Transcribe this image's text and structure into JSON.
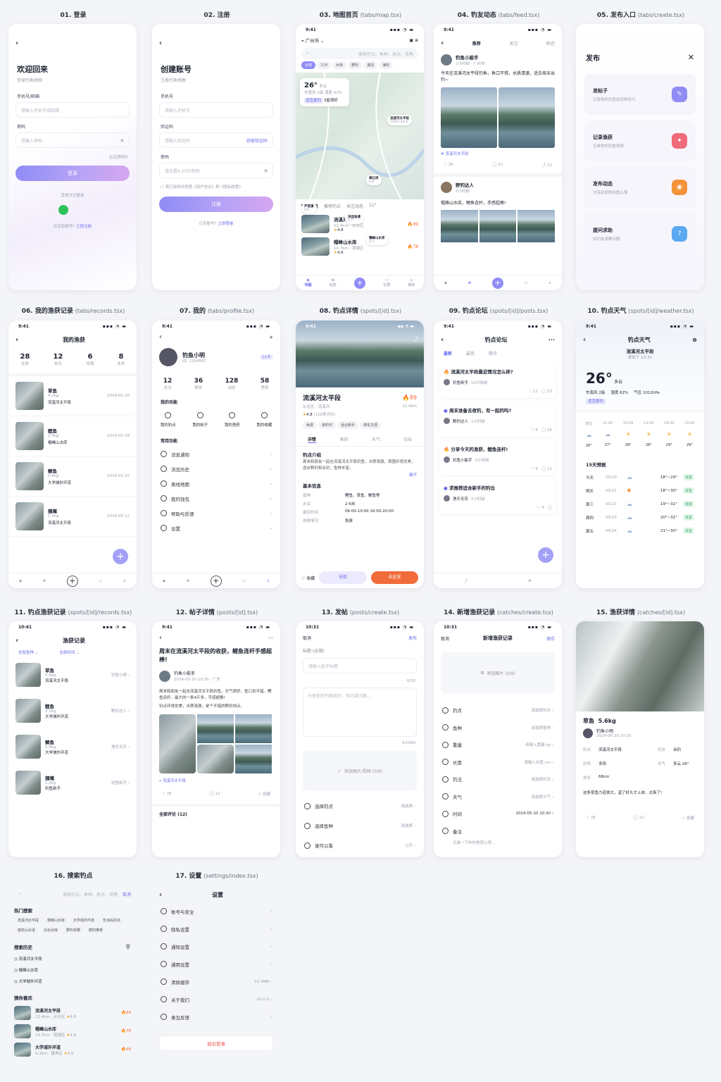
{
  "captions": [
    {
      "n": "01. 登录",
      "p": ""
    },
    {
      "n": "02. 注册",
      "p": ""
    },
    {
      "n": "03. 地图首页",
      "p": "(tabs/map.tsx)"
    },
    {
      "n": "04. 钓友动态",
      "p": "(tabs/feed.tsx)"
    },
    {
      "n": "05. 发布入口",
      "p": "(tabs/create.tsx)"
    },
    {
      "n": "06. 我的渔获记录",
      "p": "(tabs/records.tsx)"
    },
    {
      "n": "07. 我的",
      "p": "(tabs/profile.tsx)"
    },
    {
      "n": "08. 钓点详情",
      "p": "(spots/[id].tsx)"
    },
    {
      "n": "09. 钓点论坛",
      "p": "(spots/[id]/posts.tsx)"
    },
    {
      "n": "10. 钓点天气",
      "p": "(spots/[id]/weather.tsx)"
    },
    {
      "n": "11. 钓点渔获记录",
      "p": "(spots/[id]/records.tsx)"
    },
    {
      "n": "12. 帖子详情",
      "p": "(posts/[id].tsx)"
    },
    {
      "n": "13. 发帖",
      "p": "(posts/create.tsx)"
    },
    {
      "n": "14. 新增渔获记录",
      "p": "(catches/create.tsx)"
    },
    {
      "n": "15. 渔获详情",
      "p": "(catches/[id].tsx)"
    },
    {
      "n": "16. 搜索钓点",
      "p": ""
    },
    {
      "n": "17. 设置",
      "p": "(settings/index.tsx)"
    }
  ],
  "login": {
    "title": "欢迎回来",
    "sub": "登录钓鱼地图",
    "l1": "手机号/邮箱",
    "ph1": "请输入手机号或邮箱",
    "l2": "密码",
    "ph2": "请输入密码",
    "forgot": "忘记密码?",
    "btn": "登录",
    "other": "其他方式登录",
    "noacc": "还没有账号?",
    "reg": "立即注册"
  },
  "register": {
    "title": "创建账号",
    "sub": "注册钓鱼地图",
    "l1": "手机号",
    "ph1": "请输入手机号",
    "l2": "验证码",
    "ph2": "请输入验证码",
    "code": "获取验证码",
    "l3": "密码",
    "ph3": "请设置6-20位密码",
    "agree": "我已阅读并同意《用户协议》和《隐私政策》",
    "btn": "注册",
    "has": "已有账号?",
    "login": "立即登录"
  },
  "map": {
    "time": "9:41",
    "city": "广州市",
    "search": "搜索钓点、鱼种、地点、攻略",
    "chips": [
      "全部",
      "江河",
      "水库",
      "野钓",
      "湖泊",
      "海钓"
    ],
    "temp": "26°",
    "weather": "多云",
    "wind": "东南风 2级",
    "hum": "湿度 63%",
    "fishing": "适宜垂钓",
    "score": "3星很好",
    "pins": [
      {
        "t": "流溪河太平段",
        "s": "150m ★4.8"
      },
      {
        "t": "黄石坝",
        "s": "4.8"
      },
      {
        "t": "芦苞镇",
        "s": "4.6"
      },
      {
        "t": "良田鱼塘",
        "s": "4.7"
      },
      {
        "t": "帽峰山水库",
        "s": "4.3"
      }
    ],
    "tabs": [
      "附近钓点",
      "推荐钓点",
      "关注动态",
      "11°"
    ],
    "list": [
      {
        "name": "流溪河太平段",
        "meta": "12.4km · 从化区",
        "rate": "4.8",
        "cnt": "28",
        "hot": "89"
      },
      {
        "name": "帽峰山水库",
        "meta": "14.7km · 增城区",
        "rate": "4.6",
        "hot": "78"
      }
    ],
    "nav": [
      "地图",
      "动态",
      "记录",
      "我的"
    ]
  },
  "feed": {
    "tabs": [
      "推荐",
      "关注",
      "附近"
    ],
    "p1": {
      "user": "钓鱼小能手",
      "time": "2小时前 · 广州市",
      "text": "今天在流溪河太平段钓鱼，鱼口不错，水质清澈，适合周末出钓~",
      "tag": "流溪河太平段",
      "likes": "28",
      "com": "12",
      "share": "12"
    },
    "p2": {
      "user": "野钓达人",
      "time": "5小时前",
      "text": "帽峰山水库，鲤鱼连杆，手感超棒!"
    }
  },
  "create": {
    "title": "发布",
    "items": [
      {
        "t": "发帖子",
        "s": "分享你的钓鱼经历和技巧",
        "c": "#8f8cf5"
      },
      {
        "t": "记录渔获",
        "s": "记录你的钓鱼收获",
        "c": "#f06b7a"
      },
      {
        "t": "发布动态",
        "s": "分享此刻的钓鱼心情",
        "c": "#f5933a"
      },
      {
        "t": "提问求助",
        "s": "向钓友请教问题",
        "c": "#5aa8f0"
      }
    ]
  },
  "records": {
    "title": "我的渔获",
    "stats": [
      {
        "v": "28",
        "l": "全部"
      },
      {
        "v": "12",
        "l": "本月"
      },
      {
        "v": "6",
        "l": "本周"
      },
      {
        "v": "8",
        "l": "本年"
      }
    ],
    "items": [
      {
        "fish": "草鱼",
        "w": "4.2kg",
        "date": "2024-05-20",
        "spot": "流溪河太平段"
      },
      {
        "fish": "鲤鱼",
        "w": "2.6kg",
        "date": "2024-05-18",
        "spot": "帽峰山水库"
      },
      {
        "fish": "鲫鱼",
        "w": "0.6kg",
        "date": "2024-05-15",
        "spot": "大学城外环道"
      },
      {
        "fish": "翘嘴",
        "w": "1.5kg",
        "date": "2024-05-12",
        "spot": "流溪河太平段"
      }
    ]
  },
  "profile": {
    "name": "钓鱼小明",
    "id": "ID: 1254567",
    "lv": "Lv.6",
    "stats": [
      {
        "v": "12",
        "l": "关注"
      },
      {
        "v": "36",
        "l": "粉丝"
      },
      {
        "v": "128",
        "l": "动态"
      },
      {
        "v": "58",
        "l": "渔获"
      }
    ],
    "func_title": "我的功能",
    "funcs": [
      "我的钓点",
      "我的帖子",
      "我的渔获",
      "我的收藏"
    ],
    "common_title": "常用功能",
    "menu": [
      "消息通知",
      "浏览历史",
      "离线地图",
      "我的钱包",
      "帮助与反馈",
      "设置"
    ]
  },
  "spot": {
    "name": "流溪河太平段",
    "hot": "89",
    "area": "从化区 · 流溪河",
    "dist": "12.4km",
    "rate": "4.8",
    "count": "(126条评价)",
    "tags": [
      "免费",
      "夜钓可",
      "适合新手",
      "停车方便"
    ],
    "tabs": [
      "详情",
      "渔获",
      "天气",
      "论坛"
    ],
    "intro_title": "钓点介绍",
    "intro": "周末和朋友一起在流溪河太平段钓鱼，水质清澈，周围环境优美，适合野钓和台钓，鱼种丰富。",
    "more": "展开",
    "basic": "基本信息",
    "info": [
      {
        "k": "鱼种",
        "v": "鲤鱼、草鱼、鲫鱼等"
      },
      {
        "k": "水深",
        "v": "2-6米"
      },
      {
        "k": "最佳时间",
        "v": "06:00-10:00  16:00-20:00"
      },
      {
        "k": "收费情况",
        "v": "免费"
      }
    ],
    "fav": "收藏",
    "nav": "导航",
    "go": "去这里"
  },
  "forum": {
    "title": "钓点论坛",
    "tabs": [
      "最新",
      "最热",
      "精华"
    ],
    "posts": [
      {
        "t": "流溪河太平段最近情况怎么样?",
        "u": "钓鱼新手",
        "time": "10分钟前",
        "l": "12",
        "c": "23"
      },
      {
        "t": "周末准备去夜钓，有一起的吗?",
        "u": "野钓达人",
        "time": "1小时前",
        "l": "6",
        "c": "15"
      },
      {
        "t": "分享今天的渔获，鲤鱼连杆!",
        "u": "钓鱼小能手",
        "time": "3小时前",
        "l": "6",
        "c": "12"
      },
      {
        "t": "求推荐适合新手的钓位",
        "u": "渔乐无穷",
        "time": "5小时前",
        "l": "4",
        "c": ""
      }
    ]
  },
  "weather": {
    "title": "钓点天气",
    "spot": "流溪河太平段",
    "upd": "更新于 10:30",
    "temp": "26°",
    "cond": "多云",
    "wind": "东南风 2级",
    "hum": "湿度 62%",
    "press": "气压",
    "pv": "1012hPa",
    "fit": "适宜垂钓",
    "hours": [
      "现在",
      "11:00",
      "12:00",
      "13:00",
      "14:00",
      "15:00"
    ],
    "htemps": [
      "26°",
      "27°",
      "28°",
      "28°",
      "29°",
      "29°"
    ],
    "d15": "15天预报",
    "days": [
      {
        "d": "今天",
        "dt": "05/20",
        "r": "18°~29°"
      },
      {
        "d": "明天",
        "dt": "05/21",
        "r": "18°~30°"
      },
      {
        "d": "周三",
        "dt": "05/22",
        "r": "19°~31°"
      },
      {
        "d": "周四",
        "dt": "05/23",
        "r": "20°~31°"
      },
      {
        "d": "周五",
        "dt": "05/24",
        "r": "21°~30°"
      }
    ],
    "good": "适宜"
  },
  "spotrec": {
    "title": "渔获记录",
    "f1": "全部鱼种",
    "f2": "全部时间",
    "items": [
      {
        "fish": "草鱼",
        "w": "5.6kg",
        "spot": "流溪河太平段",
        "u": "钓鱼小明"
      },
      {
        "fish": "鲤鱼",
        "w": "3.2kg",
        "spot": "大学城外环道",
        "u": "野钓达人"
      },
      {
        "fish": "鲫鱼",
        "w": "0.8kg",
        "spot": "大学城外环道",
        "u": "渔乐无穷"
      },
      {
        "fish": "翘嘴",
        "w": "1.2kg",
        "spot": "钓鱼新手",
        "u": "钓鱼新手"
      }
    ]
  },
  "post": {
    "title": "周末在流溪河太平段的收获，鲤鱼连杆手感超棒!",
    "user": "钓鱼小能手",
    "time": "2024-05-20 10:30 · 广东",
    "body": "周末和朋友一起去流溪河太平段钓鱼，天气很好，鱼口也不错。鲤鱼连杆，最大的一条4斤多，手感超棒!",
    "body2": "钓点环境优美，水质清澈，是个不错的野钓地点。",
    "tag": "流溪河太平段",
    "likes": "28",
    "com": "12",
    "fav": "收藏",
    "comments": "全部评论 (12)"
  },
  "newpost": {
    "cancel": "取消",
    "pub": "发布",
    "t": "标题 (必填)",
    "ph": "请输入帖子标题",
    "c1": "0/30",
    "body": "分享你的钓鱼经历、技巧或问题...",
    "c2": "0/1000",
    "add": "添加图片/视频 (0/9)",
    "rows": [
      {
        "k": "选择钓点",
        "v": "请选择"
      },
      {
        "k": "选择鱼种",
        "v": "请选择"
      },
      {
        "k": "谁可以看",
        "v": "公开"
      }
    ]
  },
  "newcatch": {
    "cancel": "取消",
    "title": "新增渔获记录",
    "save": "保存",
    "add": "添加图片 (0/9)",
    "rows": [
      {
        "k": "钓点",
        "v": "请选择钓点"
      },
      {
        "k": "鱼种",
        "v": "请选择鱼种"
      },
      {
        "k": "重量",
        "v": "请输入重量  kg"
      },
      {
        "k": "长度",
        "v": "请输入长度  cm"
      },
      {
        "k": "钓法",
        "v": "请选择钓法"
      },
      {
        "k": "天气",
        "v": "请选择天气"
      },
      {
        "k": "时间",
        "v": "2024-05-20  10:30"
      },
      {
        "k": "备注",
        "v": ""
      }
    ],
    "note": "记录一下你的渔获心得..."
  },
  "catch": {
    "fish": "草鱼",
    "w": "5.6kg",
    "user": "钓鱼小明",
    "time": "2024-05-20 10:30",
    "spotk": "钓点",
    "spot": "流溪河太平段",
    "methodk": "钓法",
    "method": "台钓",
    "baitk": "钓饵",
    "bait": "多钩",
    "wk": "天气",
    "wv": "多云 26°",
    "lenk": "体长",
    "len": "68cm",
    "note": "这条草鱼力道很大，溜了好久才上岸，太爽了!",
    "likes": "28",
    "com": "12",
    "fav": "收藏"
  },
  "search": {
    "ph": "搜索钓点、鱼种、地点、攻略",
    "cancel": "取消",
    "hot": "热门搜索",
    "hots": [
      "流溪河太平段",
      "帽峰山水库",
      "大学城外环道",
      "长洲岛钓点",
      "莲花山水道",
      "白云水库",
      "野钓攻略",
      "鼓钓推荐"
    ],
    "hist": "搜索历史",
    "hists": [
      "流溪河太平段",
      "帽峰山水库",
      "大学城外环道"
    ],
    "guess": "猜你喜欢",
    "spots": [
      {
        "n": "流溪河太平段",
        "m": "12.4km · 从化区",
        "r": "4.8",
        "h": "89"
      },
      {
        "n": "帽峰山水库",
        "m": "14.7km · 增城区",
        "r": "4.6",
        "h": "78"
      },
      {
        "n": "大学城外环道",
        "m": "6.3km · 番禺区",
        "r": "4.5",
        "h": "68"
      }
    ]
  },
  "settings": {
    "title": "设置",
    "items": [
      {
        "k": "账号与安全",
        "v": ""
      },
      {
        "k": "隐私设置",
        "v": ""
      },
      {
        "k": "通知设置",
        "v": ""
      },
      {
        "k": "通用设置",
        "v": ""
      },
      {
        "k": "清除缓存",
        "v": "12.3MB"
      },
      {
        "k": "关于我们",
        "v": "v1.0.0"
      },
      {
        "k": "意见反馈",
        "v": ""
      }
    ],
    "logout": "退出登录"
  },
  "time": "9:41",
  "time2": "10:41",
  "time3": "10:31"
}
